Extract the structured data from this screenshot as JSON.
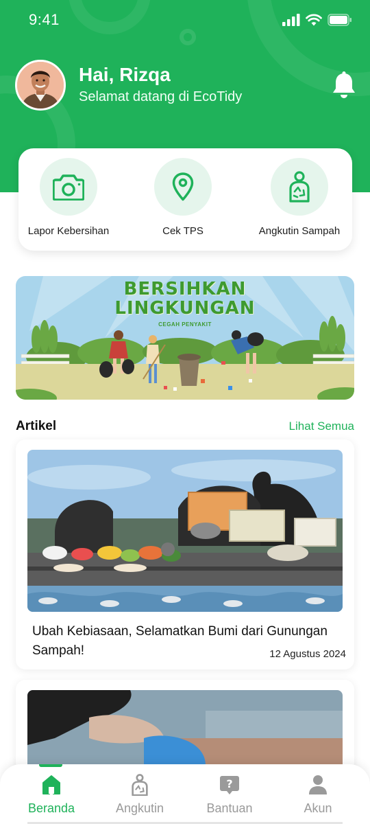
{
  "status_bar": {
    "time": "9:41"
  },
  "header": {
    "greeting": "Hai, Rizqa",
    "welcome": "Selamat datang di EcoTidy"
  },
  "quick_actions": [
    {
      "label": "Lapor Kebersihan",
      "icon": "camera-icon"
    },
    {
      "label": "Cek TPS",
      "icon": "location-pin-icon"
    },
    {
      "label": "Angkutin Sampah",
      "icon": "recycle-person-icon"
    }
  ],
  "banner": {
    "title_line1": "BERSIHKAN",
    "title_line2": "LINGKUNGAN",
    "subtitle": "CEGAH PENYAKIT"
  },
  "articles_section": {
    "title": "Artikel",
    "see_all": "Lihat Semua"
  },
  "articles": [
    {
      "title": "Ubah Kebiasaan, Selamatkan Bumi dari Gunungan Sampah!",
      "date": "12 Agustus 2024"
    }
  ],
  "bottom_nav": [
    {
      "label": "Beranda",
      "icon": "home-icon",
      "active": true
    },
    {
      "label": "Angkutin",
      "icon": "recycle-person-icon",
      "active": false
    },
    {
      "label": "Bantuan",
      "icon": "help-bubble-icon",
      "active": false
    },
    {
      "label": "Akun",
      "icon": "user-icon",
      "active": false
    }
  ],
  "colors": {
    "primary": "#1fb25a",
    "primary_light": "#e5f5ec",
    "inactive": "#9a9a9a"
  }
}
